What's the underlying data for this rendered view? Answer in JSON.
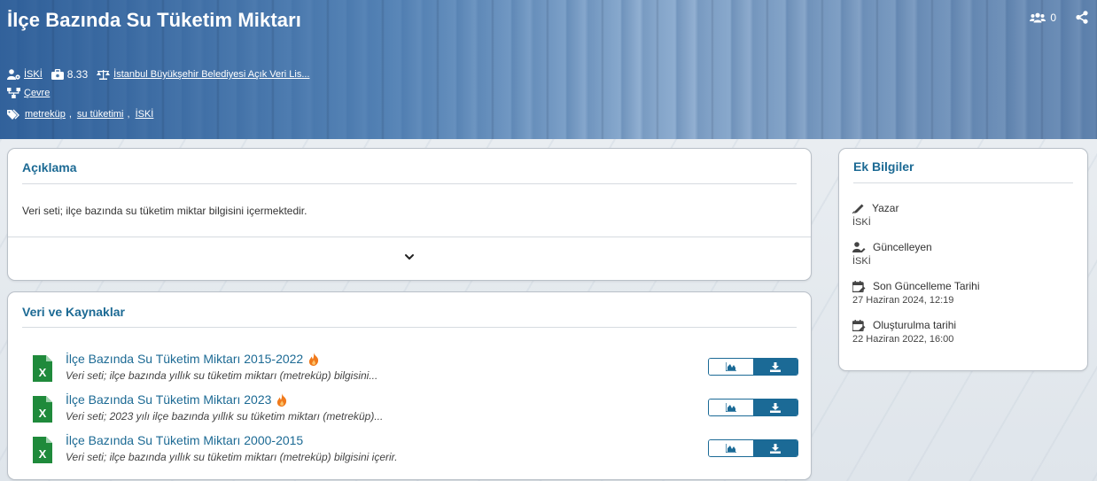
{
  "header": {
    "title": "İlçe Bazında Su Tüketim Miktarı",
    "followers": "0",
    "organization": "İSKİ",
    "score": "8.33",
    "license": "İstanbul Büyükşehir Belediyesi Açık Veri Lis...",
    "group": "Çevre",
    "tags": [
      "metreküp",
      "su tüketimi",
      "İSKİ"
    ]
  },
  "description": {
    "title": "Açıklama",
    "text": "Veri seti; ilçe bazında su tüketim miktar bilgisini içermektedir."
  },
  "resources": {
    "title": "Veri ve Kaynaklar",
    "items": [
      {
        "name": "İlçe Bazında Su Tüketim Miktarı 2015-2022",
        "desc": "Veri seti; ilçe bazında yıllık su tüketim miktarı (metreküp) bilgisini...",
        "hot": true
      },
      {
        "name": "İlçe Bazında Su Tüketim Miktarı 2023",
        "desc": "Veri seti; 2023 yılı ilçe bazında yıllık su tüketim miktarı (metreküp)...",
        "hot": true
      },
      {
        "name": "İlçe Bazında Su Tüketim Miktarı 2000-2015",
        "desc": "Veri seti; ilçe bazında yıllık su tüketim miktarı (metreküp) bilgisini içerir.",
        "hot": false
      }
    ]
  },
  "info": {
    "title": "Ek Bilgiler",
    "items": [
      {
        "label": "Yazar",
        "value": "İSKİ",
        "icon": "pencil-icon"
      },
      {
        "label": "Güncelleyen",
        "value": "İSKİ",
        "icon": "user-edit-icon"
      },
      {
        "label": "Son Güncelleme Tarihi",
        "value": "27 Haziran 2024, 12:19",
        "icon": "calendar-edit-icon"
      },
      {
        "label": "Oluşturulma tarihi",
        "value": "22 Haziran 2022, 16:00",
        "icon": "calendar-edit-icon"
      }
    ]
  },
  "colors": {
    "accent": "#1c6a94",
    "excel": "#1f8a3b",
    "fire": "#f07a1c"
  }
}
